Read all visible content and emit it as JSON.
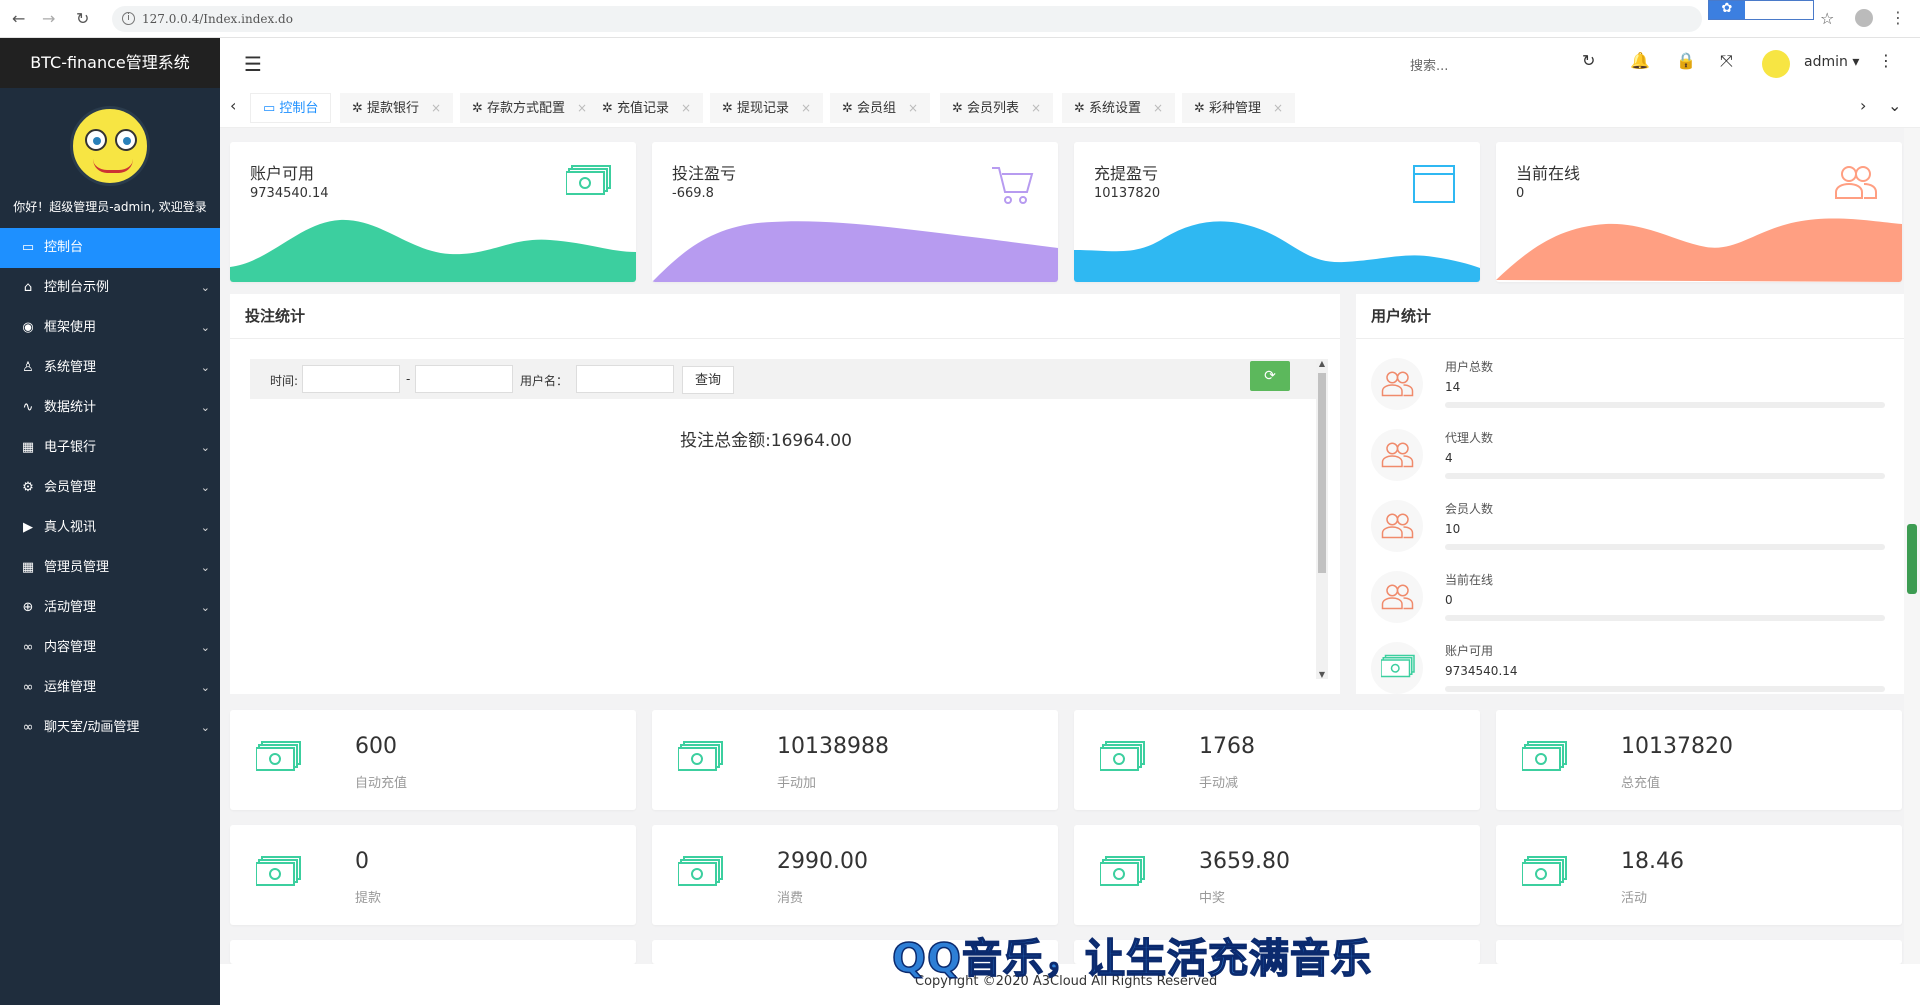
{
  "browser": {
    "url": "127.0.0.4/Index.index.do"
  },
  "app": {
    "title": "BTC-finance管理系统",
    "welcome": "你好！超级管理员-admin, 欢迎登录",
    "copyright": "Copyright ©2020 A3Cloud All Rights Reserved"
  },
  "topbar": {
    "search_placeholder": "搜索...",
    "user": "admin"
  },
  "sidebar": {
    "items": [
      {
        "label": "控制台",
        "icon": "monitor-icon",
        "active": true
      },
      {
        "label": "控制台示例",
        "icon": "home-icon"
      },
      {
        "label": "框架使用",
        "icon": "circle-icon"
      },
      {
        "label": "系统管理",
        "icon": "user-icon"
      },
      {
        "label": "数据统计",
        "icon": "pulse-icon"
      },
      {
        "label": "电子银行",
        "icon": "bank-icon"
      },
      {
        "label": "会员管理",
        "icon": "gear-icon"
      },
      {
        "label": "真人视讯",
        "icon": "video-icon"
      },
      {
        "label": "管理员管理",
        "icon": "grid-icon"
      },
      {
        "label": "活动管理",
        "icon": "plus-circle-icon"
      },
      {
        "label": "内容管理",
        "icon": "link-icon"
      },
      {
        "label": "运维管理",
        "icon": "link-icon"
      },
      {
        "label": "聊天室/动画管理",
        "icon": "link-icon"
      }
    ]
  },
  "tabs": [
    {
      "label": "控制台",
      "active": true
    },
    {
      "label": "提款银行"
    },
    {
      "label": "存款方式配置"
    },
    {
      "label": "充值记录"
    },
    {
      "label": "提现记录"
    },
    {
      "label": "会员组"
    },
    {
      "label": "会员列表"
    },
    {
      "label": "系统设置"
    },
    {
      "label": "彩种管理"
    }
  ],
  "stat_cards": [
    {
      "label": "账户可用",
      "value": "9734540.14",
      "color": "#3ccf9f",
      "icon": "money-icon"
    },
    {
      "label": "投注盈亏",
      "value": "-669.8",
      "color": "#b79bf0",
      "icon": "cart-icon"
    },
    {
      "label": "充提盈亏",
      "value": "10137820",
      "color": "#2fb8f2",
      "icon": "window-icon"
    },
    {
      "label": "当前在线",
      "value": "0",
      "color": "#ff9f82",
      "icon": "users-icon"
    }
  ],
  "bet_panel": {
    "title": "投注统计",
    "time_label": "时间:",
    "dash": "-",
    "username_label": "用户名：",
    "query_button": "查询",
    "total_label": "投注总金额:16964.00"
  },
  "user_panel": {
    "title": "用户统计",
    "rows": [
      {
        "label": "用户总数",
        "value": "14",
        "icon": "users-icon"
      },
      {
        "label": "代理人数",
        "value": "4",
        "icon": "users-icon"
      },
      {
        "label": "会员人数",
        "value": "10",
        "icon": "users-icon"
      },
      {
        "label": "当前在线",
        "value": "0",
        "icon": "users-icon"
      },
      {
        "label": "账户可用",
        "value": "9734540.14",
        "icon": "money-icon"
      }
    ]
  },
  "summary_cards": [
    {
      "value": "600",
      "label": "自动充值"
    },
    {
      "value": "10138988",
      "label": "手动加"
    },
    {
      "value": "1768",
      "label": "手动减"
    },
    {
      "value": "10137820",
      "label": "总充值"
    },
    {
      "value": "0",
      "label": "提款"
    },
    {
      "value": "2990.00",
      "label": "消费"
    },
    {
      "value": "3659.80",
      "label": "中奖"
    },
    {
      "value": "18.46",
      "label": "活动"
    }
  ],
  "overlay": {
    "qq_music": "QQ音乐，让生活充满音乐"
  }
}
